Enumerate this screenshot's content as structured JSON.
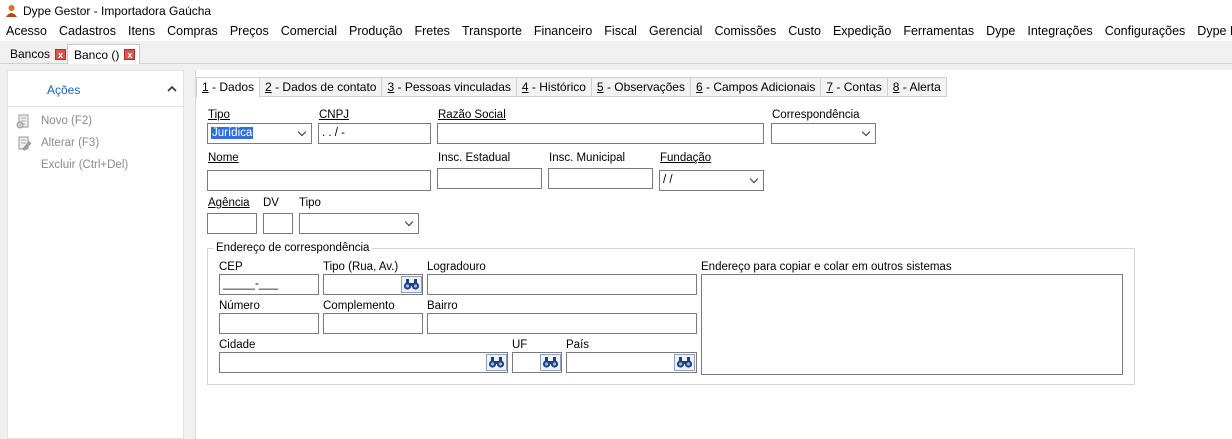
{
  "window": {
    "title": "Dype Gestor - Importadora Gaúcha"
  },
  "menu": [
    "Acesso",
    "Cadastros",
    "Itens",
    "Compras",
    "Preços",
    "Comercial",
    "Produção",
    "Fretes",
    "Transporte",
    "Financeiro",
    "Fiscal",
    "Gerencial",
    "Comissões",
    "Custo",
    "Expedição",
    "Ferramentas",
    "Dype",
    "Integrações",
    "Configurações",
    "Dype Dev"
  ],
  "doc_tabs": [
    {
      "label": "Bancos",
      "close": "x"
    },
    {
      "label": "Banco ()",
      "close": "x"
    }
  ],
  "actions": {
    "title": "Ações",
    "items": [
      {
        "label": "Novo (F2)"
      },
      {
        "label": "Alterar (F3)"
      },
      {
        "label": "Excluir (Ctrl+Del)"
      }
    ]
  },
  "form_tabs": [
    {
      "key": "1",
      "label": " - Dados"
    },
    {
      "key": "2",
      "label": " - Dados de contato"
    },
    {
      "key": "3",
      "label": " - Pessoas vinculadas"
    },
    {
      "key": "4",
      "label": " - Histórico"
    },
    {
      "key": "5",
      "label": " - Observações"
    },
    {
      "key": "6",
      "label": " - Campos Adicionais"
    },
    {
      "key": "7",
      "label": " - Contas"
    },
    {
      "key": "8",
      "label": " - Alerta"
    }
  ],
  "form": {
    "tipo_label": "Tipo",
    "tipo_value": "Jurídica",
    "cnpj_label": "CNPJ",
    "cnpj_value": " .  .  /  -",
    "razao_label": "Razão Social",
    "razao_value": "",
    "corresp_label": "Correspondência",
    "corresp_value": "",
    "nome_label": "Nome",
    "nome_value": "",
    "insc_est_label": "Insc. Estadual",
    "insc_est_value": "",
    "insc_mun_label": "Insc. Municipal",
    "insc_mun_value": "",
    "fundacao_label": "Fundação",
    "fundacao_value": " / /",
    "agencia_label": "Agência",
    "agencia_value": "",
    "dv_label": "DV",
    "dv_value": "",
    "tipo_conta_label": "Tipo",
    "tipo_conta_value": ""
  },
  "address": {
    "group_title": "Endereço de correspondência",
    "cep_label": "CEP",
    "cep_value": "_____-___",
    "tipo_label": "Tipo (Rua, Av.)",
    "tipo_value": "",
    "logradouro_label": "Logradouro",
    "logradouro_value": "",
    "copy_label": "Endereço para copiar e colar em outros sistemas",
    "numero_label": "Número",
    "numero_value": "",
    "complemento_label": "Complemento",
    "complemento_value": "",
    "bairro_label": "Bairro",
    "bairro_value": "",
    "cidade_label": "Cidade",
    "cidade_value": "",
    "uf_label": "UF",
    "uf_value": "",
    "pais_label": "País",
    "pais_value": ""
  },
  "colors": {
    "accent": "#1c62b0",
    "selection": "#2f6fd8",
    "close": "#d9534f"
  }
}
